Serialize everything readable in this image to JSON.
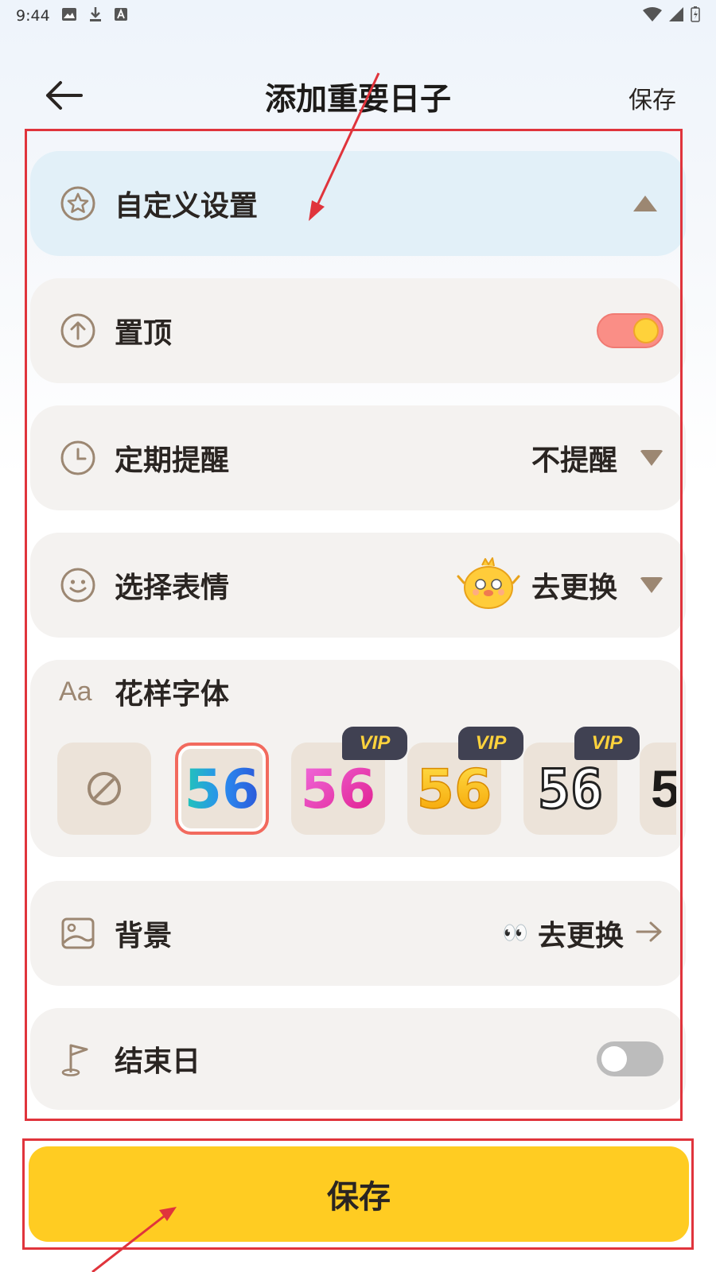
{
  "status_bar": {
    "time": "9:44"
  },
  "header": {
    "title": "添加重要日子",
    "save_label": "保存"
  },
  "sections": {
    "custom": {
      "label": "自定义设置"
    },
    "pin": {
      "label": "置顶",
      "enabled": true
    },
    "reminder": {
      "label": "定期提醒",
      "value": "不提醒"
    },
    "emoji": {
      "label": "选择表情",
      "value": "去更换"
    },
    "font": {
      "label": "花样字体",
      "aa": "Aa",
      "tiles": [
        {
          "text": "",
          "type": "none"
        },
        {
          "text": "56",
          "type": "gradient-blue",
          "selected": true
        },
        {
          "text": "56",
          "type": "pink",
          "vip": "VIP"
        },
        {
          "text": "56",
          "type": "gold",
          "vip": "VIP"
        },
        {
          "text": "56",
          "type": "outline",
          "vip": "VIP"
        },
        {
          "text": "5",
          "type": "black"
        }
      ]
    },
    "background": {
      "label": "背景",
      "eyes": "👀",
      "value": "去更换"
    },
    "end_day": {
      "label": "结束日",
      "enabled": false
    }
  },
  "bottom": {
    "save_label": "保存"
  },
  "colors": {
    "accent": "#ffcc22",
    "card_bg": "#f4f2f0",
    "highlight_card_bg": "#e2f0f8",
    "icon_color": "#9c8772",
    "annotation_red": "#e0343c"
  }
}
